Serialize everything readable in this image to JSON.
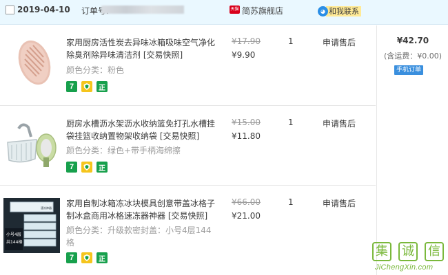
{
  "order": {
    "date": "2019-04-10",
    "order_no_label": "订单号:",
    "shop_badge": "天猫",
    "shop_name": "简苏旗舰店",
    "contact_label": "和我联系"
  },
  "items": [
    {
      "title": "家用厨房活性炭去异味冰箱吸味空气净化除臭剂除异味清洁剂",
      "snapshot": "[交易快照]",
      "spec": "颜色分类：粉色",
      "original_price": "¥17.90",
      "price": "¥9.90",
      "quantity": "1",
      "action": "申请售后"
    },
    {
      "title": "厨房水槽沥水架沥水收纳篮免打孔水槽挂袋挂篮收纳置物架收纳袋",
      "snapshot": "[交易快照]",
      "spec": "颜色分类：绿色+带手柄海绵擦",
      "original_price": "¥15.00",
      "price": "¥11.80",
      "quantity": "1",
      "action": "申请售后"
    },
    {
      "title": "家用自制冰箱冻冰块模具创意带盖冰格子制冰盒商用冰格速冻器神器",
      "snapshot": "[交易快照]",
      "spec": "颜色分类：升级款密封盖：小号4层144格",
      "original_price": "¥66.00",
      "price": "¥21.00",
      "quantity": "1",
      "action": "申请售后",
      "thumb_caption_1": "小号4层",
      "thumb_caption_2": "共144格",
      "thumb_tag": "速冻神器"
    }
  ],
  "badges": {
    "seven": "7",
    "zheng": "正"
  },
  "summary": {
    "total": "¥42.70",
    "shipping": "(含运费：¥0.00)",
    "mobile_order": "手机订单"
  },
  "watermark": {
    "chars": [
      "集",
      "诚",
      "信"
    ],
    "url": "JiChengXin.com"
  },
  "colors": {
    "header_bg": "#eaf8ff",
    "badge_green": "#17a04c",
    "badge_yellow": "#f5c51d",
    "mobile_blue": "#3a8fde",
    "tmall_red": "#d9001b",
    "watermark_green": "#7ab83b"
  }
}
